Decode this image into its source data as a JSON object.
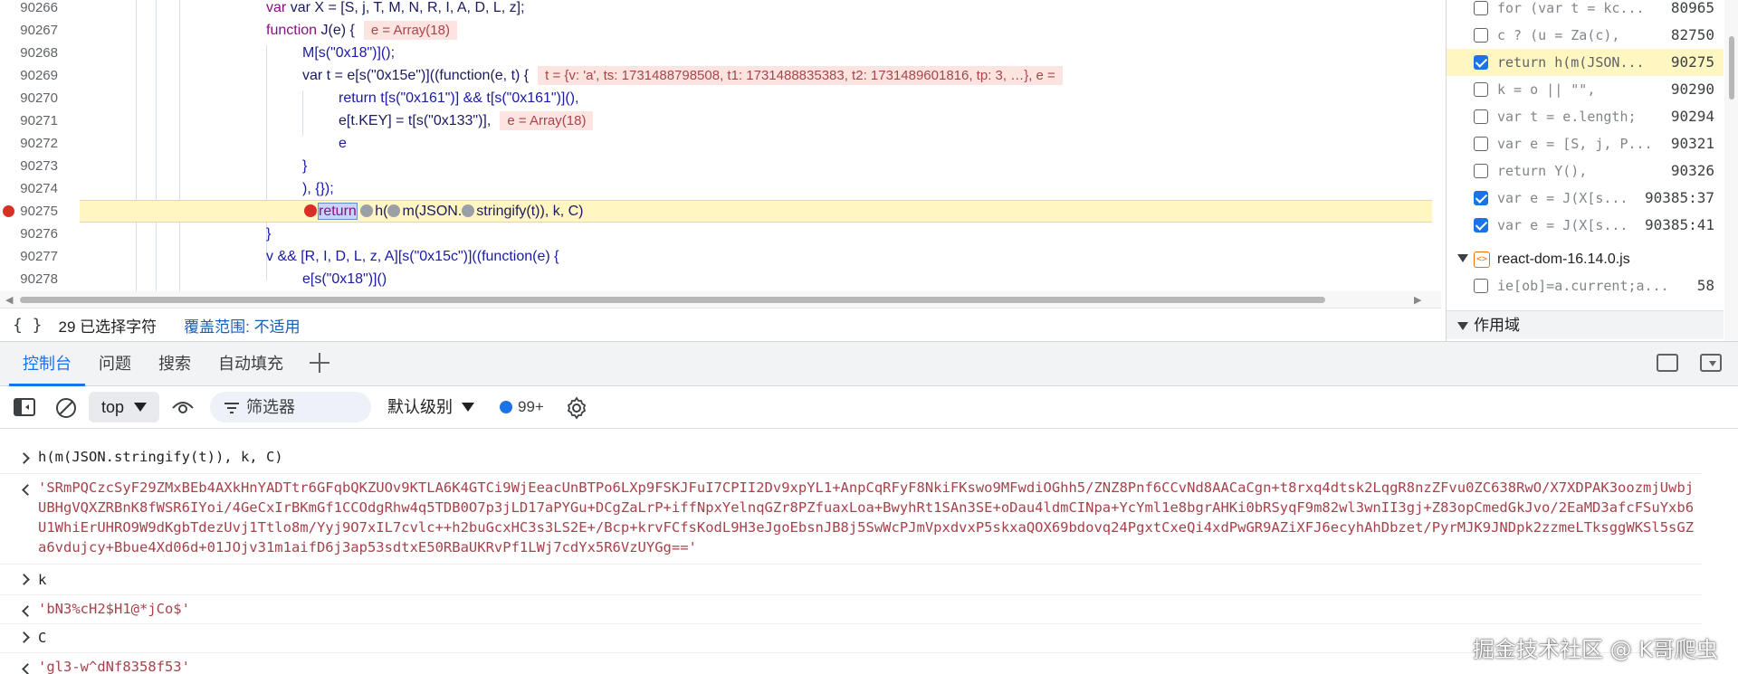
{
  "editor": {
    "lines": [
      {
        "num": "90266",
        "code": "var X = [S, j, T, M, N, R, I, A, D, L, z];"
      },
      {
        "num": "90267",
        "code_kw": "function",
        "code": " J(e) {",
        "inline": "e = Array(18)"
      },
      {
        "num": "90268",
        "code": "M[s(\"0x18\")]();"
      },
      {
        "num": "90269",
        "code": "var t = e[s(\"0x15e\")]((function(e, t) {",
        "inline": "t = {v: 'a', ts: 1731488798508, t1: 1731488835383, t2: 1731489601816, tp: 3, …}, e ="
      },
      {
        "num": "90270",
        "code": "return t[s(\"0x161\")] && t[s(\"0x161\")](),"
      },
      {
        "num": "90271",
        "code": "e[t.KEY] = t[s(\"0x133\")],",
        "inline": "e = Array(18)"
      },
      {
        "num": "90272",
        "code": "e"
      },
      {
        "num": "90273",
        "code": "}"
      },
      {
        "num": "90274",
        "code": "), {});"
      },
      {
        "num": "90275",
        "code_kw": "return",
        "code": "h(m(JSON.stringify(t)), k, C)"
      },
      {
        "num": "90276",
        "code": "}"
      },
      {
        "num": "90277",
        "code": "v && [R, I, D, L, z, A][s(\"0x15c\")]((function(e) {"
      },
      {
        "num": "90278",
        "code": "e[s(\"0x18\")]()"
      }
    ]
  },
  "status_bar": {
    "braces": "{ }",
    "selected": "29 已选择字符",
    "coverage": "覆盖范围: 不适用"
  },
  "breakpoints": {
    "items": [
      {
        "text": "for (var t = kc...",
        "line": "80965",
        "checked": false
      },
      {
        "text": "c ? (u = Za(c),",
        "line": "82750",
        "checked": false
      },
      {
        "text": "return h(m(JSON...",
        "line": "90275",
        "checked": true
      },
      {
        "text": "k = o || \"\",",
        "line": "90290",
        "checked": false
      },
      {
        "text": "var t = e.length;",
        "line": "90294",
        "checked": false
      },
      {
        "text": "var e = [S, j, P...",
        "line": "90321",
        "checked": false
      },
      {
        "text": "return Y(),",
        "line": "90326",
        "checked": false
      },
      {
        "text": "var e = J(X[s...",
        "line": "90385:37",
        "checked": true
      },
      {
        "text": "var e = J(X[s...",
        "line": "90385:41",
        "checked": true
      }
    ],
    "file": {
      "name": "react-dom-16.14.0.js"
    },
    "file_item": {
      "text": "ie[ob]=a.current;a...",
      "line": "58",
      "checked": false
    },
    "scope_label": "作用域"
  },
  "drawer": {
    "tabs": [
      "控制台",
      "问题",
      "搜索",
      "自动填充"
    ]
  },
  "toolbar": {
    "context": "top",
    "filter_placeholder": "筛选器",
    "levels": "默认级别",
    "issues_count": "99+"
  },
  "console": {
    "messages": [
      {
        "type": "in",
        "text": "h(m(JSON.stringify(t)), k, C)"
      },
      {
        "type": "out",
        "text": "'SRmPQCzcSyF29ZMxBEb4AXkHnYADTtr6GFqbQKZUOv9KTLA6K4GTCi9WjEeacUnBTPo6LXp9FSKJFuI7CPII2Dv9xpYL1+AnpCqRFyF8NkiFKswo9MFwdiOGhh5/ZNZ8Pnf6CCvNd8AACaCgn+t8rxq4dtsk2LqgR8nzZFvu0ZC638RwO/X7XDPAK3oozmjUwbjUBHgVQXZRBnK8fWSR6IYoi/4GeCxIrBKmGf1CCOdgRhw4q5TDB0O7p3jLD17aPYGu+DCgZaLrP+iffNpxYelnqGZr8PZfuaxLoa+BwyhRt1SAn3SE+oDau4ldmCINpa+YcYml1e8bgrAHKi0bRSyqF9m82wl3wnII3gj+Z83opCmedGkJvo/2EaMD3afcFSuYxb6U1WhiErUHRO9W9dKgbTdezUvj1Ttlo8m/Yyj9O7xIL7cvlc++h2buGcxHC3s3LS2E+/Bcp+krvFCfsKodL9H3eJgoEbsnJB8j5SwWcPJmVpxdvxP5skxaQOX69bdovq24PgxtCxeQi4xdPwGR9AZiXFJ6ecyhAhDbzet/PyrMJK9JNDpk2zzmeLTksggWKSl5sGZa6vdujcy+Bbue4Xd06d+01JOjv31m1aifD6j3ap53sdtxE50RBaUKRvPf1LWj7cdYx5R6VzUYGg=='"
      },
      {
        "type": "in",
        "text": "k"
      },
      {
        "type": "out",
        "text": "'bN3%cH2$H1@*jCo$'"
      },
      {
        "type": "in",
        "text": "C"
      },
      {
        "type": "out",
        "text": "'gl3-w^dNf8358f53'"
      }
    ]
  },
  "watermark": "掘金技术社区 @ K哥爬虫",
  "colors": {
    "accent": "#1a73e8",
    "breakpoint": "#d93025",
    "paused_line": "#fff6c2",
    "inline_value_bg": "#fde4e0",
    "string_result": "#a6424b"
  }
}
